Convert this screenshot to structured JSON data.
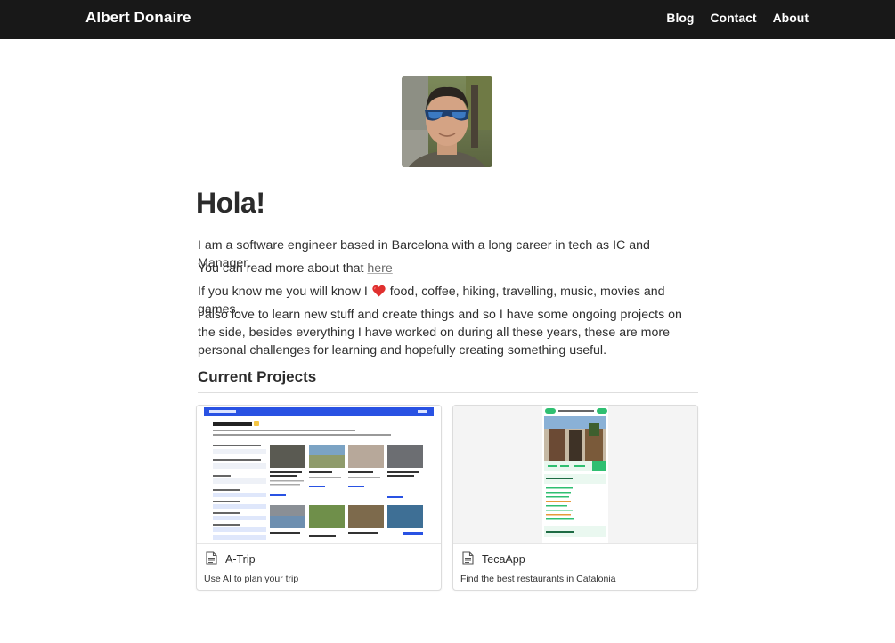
{
  "header": {
    "brand": "Albert Donaire",
    "nav": [
      {
        "label": "Blog"
      },
      {
        "label": "Contact"
      },
      {
        "label": "About"
      }
    ]
  },
  "intro": {
    "greeting": "Hola!",
    "p1": "I am a software engineer based in Barcelona with a long career in tech as IC and Manager.",
    "p2_prefix": "You can read more about that ",
    "p2_link": "here",
    "p3_prefix": "If you know me you will know I ",
    "p3_suffix": " food, coffee, hiking, travelling, music, movies and games.",
    "p4": "I also love to learn new stuff and create things and so I have some ongoing projects on the side, besides everything I have worked on during all these years, these are more personal challenges for learning and hopefully creating something useful."
  },
  "projects": {
    "heading": "Current Projects",
    "items": [
      {
        "title": "A-Trip",
        "description": "Use AI to plan your trip"
      },
      {
        "title": "TecaApp",
        "description": "Find the best restaurants in Catalonia"
      }
    ]
  },
  "icons": {
    "heart": "heart-icon",
    "document": "document-icon"
  },
  "colors": {
    "navbar": "#181818",
    "atrip_accent": "#2952e3",
    "teca_accent": "#2fbf71"
  }
}
